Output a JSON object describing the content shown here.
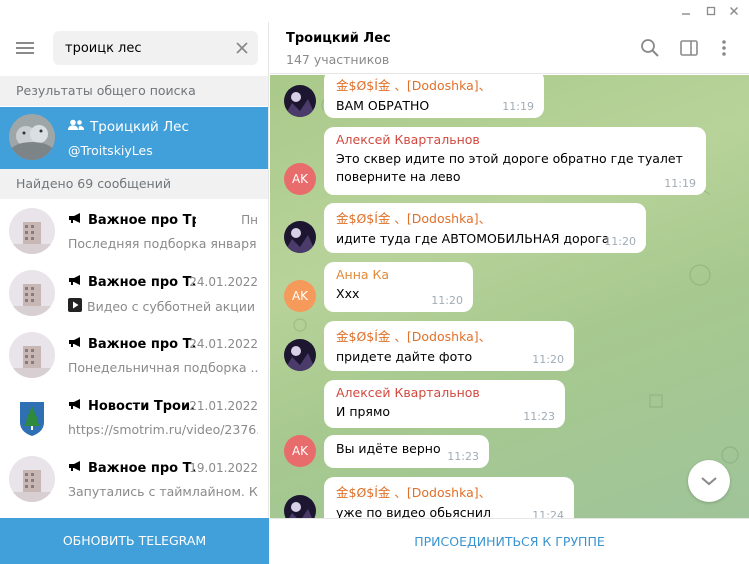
{
  "window": {
    "minimize_icon": "minimize-icon",
    "maximize_icon": "maximize-icon",
    "close_icon": "close-icon"
  },
  "search": {
    "value": "троицк лес",
    "placeholder": ""
  },
  "sections": {
    "global": "Результаты общего поиска",
    "found": "Найдено 69 сообщений"
  },
  "global_result": {
    "name": "Троицкий Лес",
    "username": "@TroitskiyLes"
  },
  "chats": [
    {
      "title": "Важное про Троицк",
      "date": "Пн",
      "preview": "Последняя подборка января"
    },
    {
      "title": "Важное про Т...",
      "date": "24.01.2022",
      "preview": "Видео с субботней акции ..."
    },
    {
      "title": "Важное про Т...",
      "date": "24.01.2022",
      "preview": "Понедельничная подборка ..."
    },
    {
      "title": "Новости Трои...",
      "date": "21.01.2022",
      "preview": "https://smotrim.ru/video/2376..."
    },
    {
      "title": "Важное про Т...",
      "date": "19.01.2022",
      "preview": "Запутались с таймлайном. К..."
    }
  ],
  "update_label": "ОБНОВИТЬ TELEGRAM",
  "chat": {
    "title": "Троицкий Лес",
    "subtitle": "147 участников",
    "join_label": "ПРИСОЕДИНИТЬСЯ К ГРУППЕ"
  },
  "messages": [
    {
      "author": "金$Ø$Í金 、[Dodoshka]、",
      "lines": [
        "ВАМ ОБРАТНО"
      ],
      "time": "11:19",
      "avatar": ""
    },
    {
      "author": "Алексей Квартальнов",
      "lines": [
        "Это сквер идите по этой дороге обратно где туалет",
        "поверните на лево"
      ],
      "time": "11:19",
      "avatar": "AK"
    },
    {
      "author": "金$Ø$Í金 、[Dodoshka]、",
      "lines": [
        "идите туда где АВТОМОБИЛЬНАЯ дорога"
      ],
      "time": "11:20",
      "avatar": ""
    },
    {
      "author": "Анна Ка",
      "lines": [
        "Xxx"
      ],
      "time": "11:20",
      "avatar": "AK"
    },
    {
      "author": "金$Ø$Í金 、[Dodoshka]、",
      "lines": [
        "придете дайте фото"
      ],
      "time": "11:20",
      "avatar": ""
    },
    {
      "author": "Алексей Квартальнов",
      "lines": [
        "И прямо"
      ],
      "time": "11:23",
      "avatar": ""
    },
    {
      "author": "",
      "lines": [
        "Вы идёте верно"
      ],
      "time": "11:23",
      "avatar": "AK"
    },
    {
      "author": "金$Ø$Í金 、[Dodoshka]、",
      "lines": [
        "уже по видео обьяснил"
      ],
      "time": "11:24",
      "avatar": ""
    }
  ],
  "colors": {
    "accent": "#419fd9",
    "author_dodoshka": "#e0702a",
    "author_alexey": "#d1493f",
    "author_anna": "#e08a3a",
    "avatar_ak": "#e96c6c",
    "avatar_anna": "#f59a5b"
  }
}
